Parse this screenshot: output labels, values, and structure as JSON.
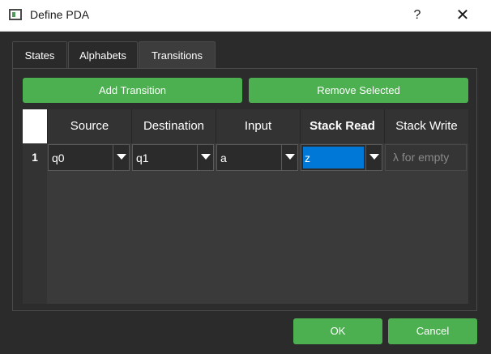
{
  "window": {
    "title": "Define PDA",
    "help_label": "?",
    "close_label": "✕"
  },
  "tabs": [
    {
      "label": "States",
      "active": false
    },
    {
      "label": "Alphabets",
      "active": false
    },
    {
      "label": "Transitions",
      "active": true
    }
  ],
  "toolbar": {
    "add_label": "Add Transition",
    "remove_label": "Remove Selected"
  },
  "table": {
    "columns": [
      "Source",
      "Destination",
      "Input",
      "Stack Read",
      "Stack Write"
    ],
    "rows": [
      {
        "number": "1",
        "source": "q0",
        "destination": "q1",
        "input": "a",
        "stack_read": "z",
        "stack_write_placeholder": "λ for empty"
      }
    ]
  },
  "footer": {
    "ok_label": "OK",
    "cancel_label": "Cancel"
  },
  "colors": {
    "accent_green": "#4caf50",
    "selection_blue": "#0078d7",
    "background": "#2b2b2b"
  }
}
